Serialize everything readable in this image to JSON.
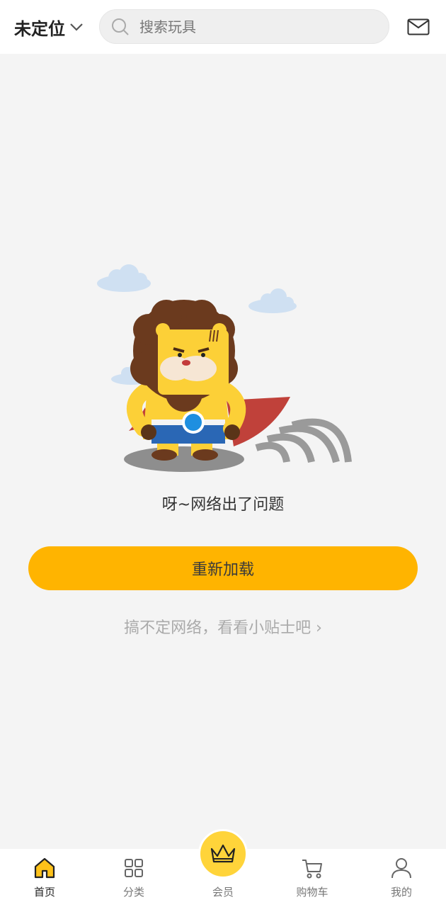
{
  "header": {
    "location_label": "未定位",
    "search_placeholder": "搜索玩具"
  },
  "main": {
    "error_message": "呀~网络出了问题",
    "reload_label": "重新加载",
    "tips_label": "搞不定网络，看看小贴士吧 ›"
  },
  "bottom_nav": {
    "items": [
      {
        "label": "首页",
        "icon": "home-icon",
        "active": true
      },
      {
        "label": "分类",
        "icon": "grid-icon",
        "active": false
      },
      {
        "label": "会员",
        "icon": "crown-icon",
        "active": false
      },
      {
        "label": "购物车",
        "icon": "cart-icon",
        "active": false
      },
      {
        "label": "我的",
        "icon": "user-icon",
        "active": false
      }
    ]
  },
  "colors": {
    "accent": "#ffb400",
    "vip": "#ffd43a",
    "background": "#f4f4f4"
  }
}
